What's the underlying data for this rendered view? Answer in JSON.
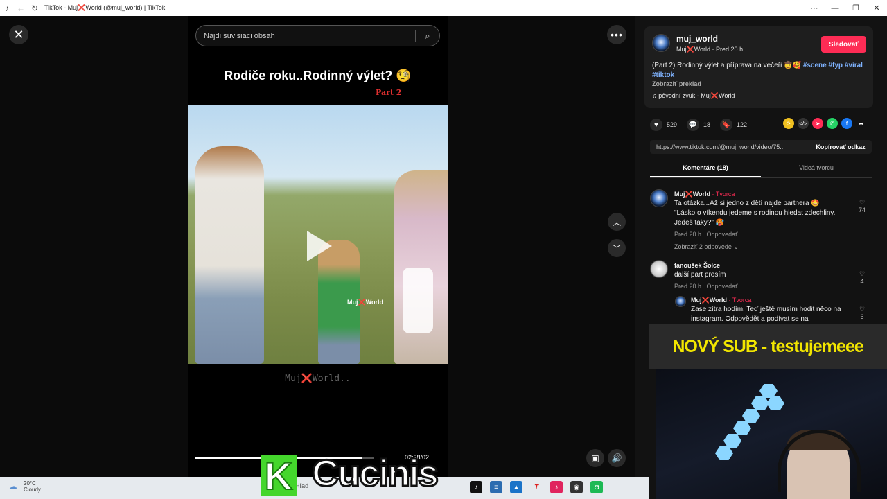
{
  "window": {
    "title": "TikTok - Muj❌World (@muj_world) | TikTok",
    "controls": {
      "minimize": "—",
      "restore": "❐",
      "close": "✕"
    },
    "menu": "⋯"
  },
  "viewer": {
    "search_placeholder": "Nájdi súvisiaci obsah",
    "video_title": "Rodiče roku..Rodinný výlet? 🧐",
    "video_part": "Part 2",
    "watermark_in": "Muj❌World",
    "watermark_out": "Muj❌World..",
    "time": "02:28/02",
    "progress_fraction": 0.93
  },
  "panel": {
    "username": "muj_world",
    "subline": "Muj❌World · Pred 20 h",
    "follow_label": "Sledovať",
    "description": "(Part 2) Rodinný výlet a příprava na večeři 🤠🥰",
    "hashtags": "#scene #fyp #viral #tiktok",
    "translate_label": "Zobraziť preklad",
    "sound": "♫  pôvodní zvuk - Muj❌World",
    "likes": "529",
    "comments": "18",
    "saves": "122",
    "link_url": "https://www.tiktok.com/@muj_world/video/75...",
    "copy_label": "Kopírovať odkaz",
    "tab_comments": "Komentáre (18)",
    "tab_creator": "Videá tvorcu",
    "comment_list": [
      {
        "author": "Muj❌World",
        "badge": "· Tvorca",
        "text": "Ta otázka...Až si jedno z dětí najde partnera 🤩 \"Lásko o víkendu jedeme s rodinou hledat zdechliny. Jedeš taky?\" 🥵",
        "time": "Pred 20 h",
        "reply": "Odpovedať",
        "replies": "Zobraziť 2 odpovede ⌄",
        "likes": "74"
      },
      {
        "author": "fanoušek Šolce",
        "text": "další part prosím",
        "time": "Pred 20 h",
        "reply": "Odpovedať",
        "likes": "4"
      },
      {
        "author": "Muj❌World",
        "badge": "· Tvorca",
        "text": "Zase zítra hodím. Teď ještě musím hodit něco na instagram. Odpovědět a podívat se na",
        "likes": "6"
      }
    ]
  },
  "overlay": {
    "sub_banner": "NOVÝ SUB - testujemeee",
    "logo_letter": "K",
    "logo_text": "Cucinis"
  },
  "taskbar": {
    "temperature": "20°C",
    "condition": "Cloudy",
    "search_text": "Hľad"
  }
}
